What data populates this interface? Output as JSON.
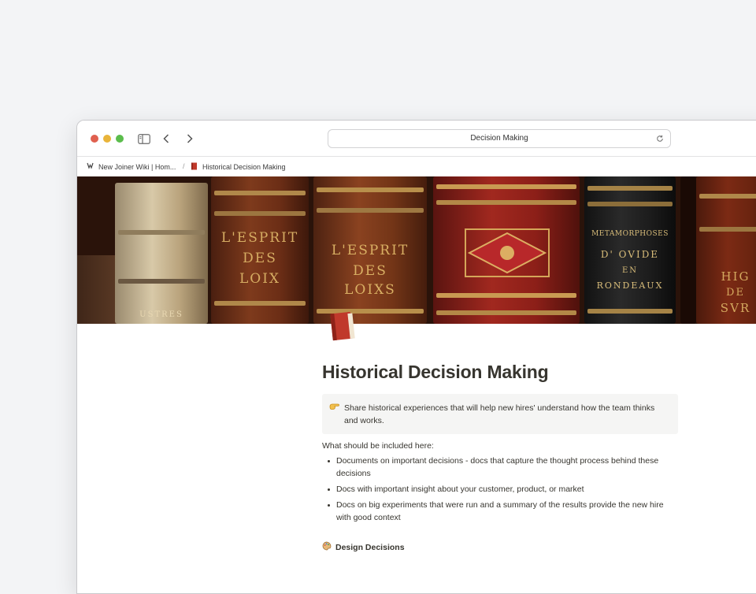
{
  "browser": {
    "url_title": "Decision Making"
  },
  "tabs": {
    "parent_label": "New Joiner Wiki | Hom...",
    "separator": "/",
    "current_label": "Historical Decision Making"
  },
  "cover": {
    "spine_texts": [
      "L'ESPRIT",
      "DES",
      "LOIX",
      "L'ESPRIT",
      "DES",
      "LOIXS",
      "METAMORPHOSES",
      "D' OVIDE",
      "EN",
      "RONDEAUX",
      "HIG",
      "DE",
      "SVR",
      "USTRES"
    ]
  },
  "page": {
    "title": "Historical Decision Making",
    "callout_text": "Share historical experiences that will help new hires' understand how the team thinks and works.",
    "intro": "What should be included here:",
    "bullets": [
      "Documents on important decisions - docs that capture the thought process behind these decisions",
      "Docs with important insight about your customer, product, or market",
      "Docs on big experiments that were run and a summary of the results provide the new hire with good context"
    ],
    "section_heading": "Design Decisions"
  },
  "colors": {
    "text": "#37352f",
    "callout_bg": "#f5f5f4",
    "window_bg": "#ffffff",
    "page_bg": "#f3f4f6"
  }
}
